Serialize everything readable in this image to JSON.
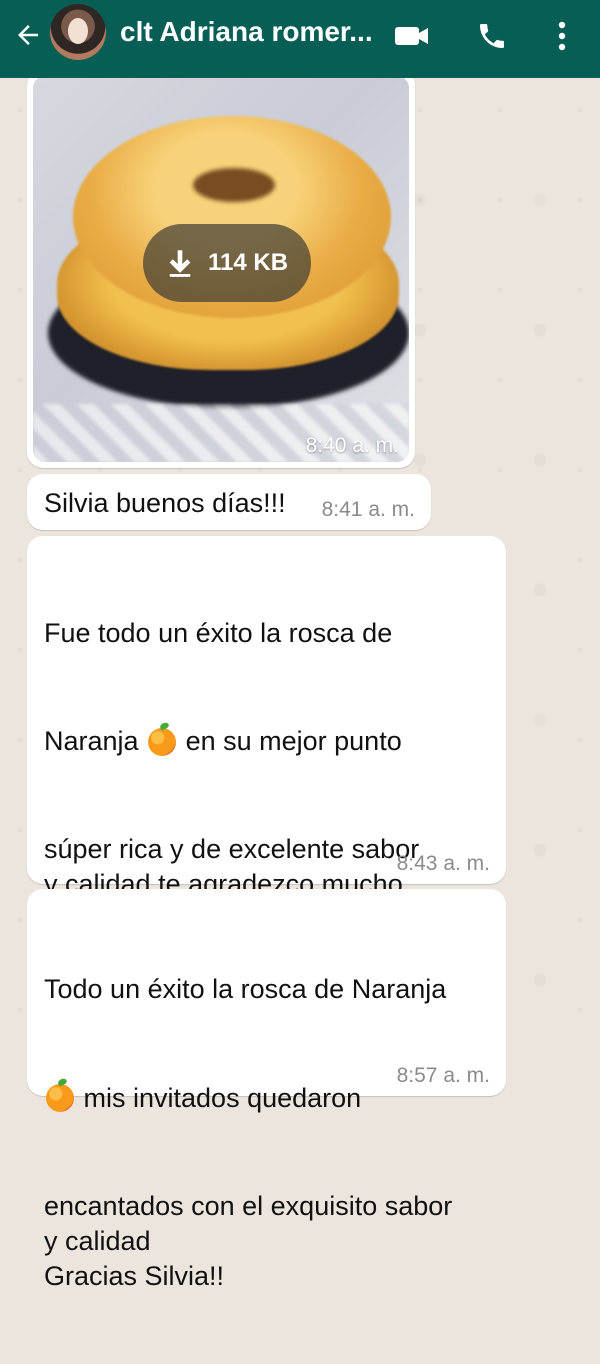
{
  "header": {
    "contact_name": "clt Adriana romer...",
    "icons": {
      "back": "arrow-left-icon",
      "video": "video-camera-icon",
      "call": "phone-icon",
      "menu": "more-vertical-icon"
    }
  },
  "messages": [
    {
      "type": "image",
      "download_size": "114 KB",
      "time": "8:40 a. m."
    },
    {
      "type": "text",
      "text": "Silvia buenos días!!!",
      "time": "8:41 a. m."
    },
    {
      "type": "text",
      "line1": "Fue todo un éxito la rosca de",
      "line2a": "Naranja ",
      "line2b": " en su mejor punto",
      "rest": "súper rica y de excelente sabor\ny calidad te agradezco mucho\nsiempre te agradezco mucho por\ntus obras de arte felicidades por\ntus atenciones\nGracias Silvia seguimos en\ncontacto",
      "time": "8:43 a. m."
    },
    {
      "type": "text",
      "line1": "Todo un éxito la rosca de Naranja",
      "line2": " mis invitados quedaron",
      "rest": "encantados con el exquisito sabor\ny calidad\nGracias Silvia!!",
      "time": "8:57 a. m."
    }
  ],
  "colors": {
    "header": "#075e54",
    "chat_background": "#ece5dd",
    "incoming_bubble": "#ffffff"
  }
}
